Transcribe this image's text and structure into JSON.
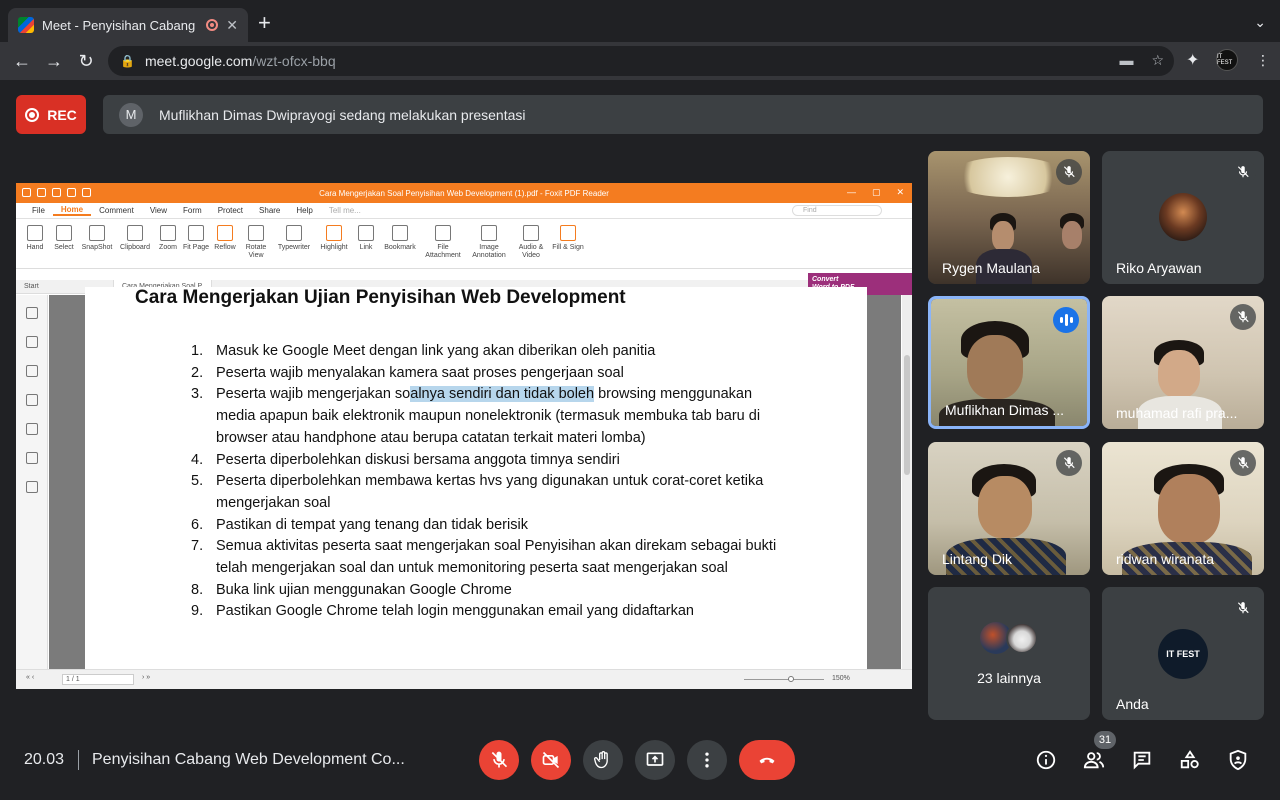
{
  "browser": {
    "tab_title": "Meet - Penyisihan Cabang",
    "url_host": "meet.google.com",
    "url_path": "/wzt-ofcx-bbq",
    "new_tab_glyph": "+",
    "profile_label": "IT FEST"
  },
  "meet": {
    "rec_label": "REC",
    "presenter_initial": "M",
    "presenting_message": "Muflikhan Dimas Dwiprayogi sedang melakukan presentasi",
    "clock": "20.03",
    "meeting_title": "Penyisihan Cabang Web Development Co...",
    "participant_count": "31"
  },
  "foxit": {
    "window_title": "Cara Mengerjakan Soal Penyisihan Web Development (1).pdf - Foxit PDF Reader",
    "menu": [
      "File",
      "Home",
      "Comment",
      "View",
      "Form",
      "Protect",
      "Share",
      "Help"
    ],
    "tell_me": "Tell me...",
    "find_placeholder": "Find",
    "ribbon": [
      "Hand",
      "Select",
      "SnapShot",
      "Clipboard",
      "Zoom",
      "Fit Page",
      "Reflow",
      "Rotate View",
      "Typewriter",
      "Highlight",
      "Link",
      "Bookmark",
      "File Attachment",
      "Image Annotation",
      "Audio & Video",
      "Fill & Sign"
    ],
    "convert_label_1": "Convert",
    "convert_label_2": "Word to PDF",
    "tabs": [
      "Start",
      "Cara Mengerjakan Soal P..."
    ],
    "page_indicator": "1 / 1",
    "zoom_level": "150%"
  },
  "document": {
    "heading": "Cara Mengerjakan Ujian Penyisihan Web Development",
    "items": [
      {
        "num": "1.",
        "text": "Masuk ke Google Meet dengan link yang akan diberikan oleh panitia"
      },
      {
        "num": "2.",
        "text": "Peserta wajib menyalakan kamera saat proses pengerjaan soal"
      },
      {
        "num": "3.",
        "text_before": "Peserta wajib mengerjakan so",
        "text_highlight": "alnya sendiri dan tidak boleh",
        "text_after": " browsing menggunakan media apapun baik elektronik maupun nonelektronik (termasuk membuka tab baru di browser atau handphone atau berupa catatan terkait materi lomba)"
      },
      {
        "num": "4.",
        "text": "Peserta diperbolehkan diskusi bersama anggota timnya sendiri"
      },
      {
        "num": "5.",
        "text": "Peserta diperbolehkan membawa kertas hvs yang digunakan untuk corat-coret ketika mengerjakan soal"
      },
      {
        "num": "6.",
        "text": "Pastikan di tempat yang tenang dan tidak berisik"
      },
      {
        "num": "7.",
        "text": "Semua aktivitas peserta saat mengerjakan soal Penyisihan akan direkam sebagai bukti telah mengerjakan soal dan untuk memonitoring peserta saat mengerjakan soal"
      },
      {
        "num": "8.",
        "text": "Buka link ujian menggunakan Google Chrome"
      },
      {
        "num": "9.",
        "text": "Pastikan Google Chrome telah login menggunakan email yang didaftarkan"
      }
    ]
  },
  "participants": [
    {
      "name": "Rygen Maulana",
      "muted": true
    },
    {
      "name": "Riko Aryawan",
      "muted": true
    },
    {
      "name": "Muflikhan Dimas ...",
      "muted": false,
      "speaking": true
    },
    {
      "name": "muhamad rafi pra...",
      "muted": true
    },
    {
      "name": "Lintang Dik",
      "muted": true
    },
    {
      "name": "ridwan wiranata",
      "muted": true
    },
    {
      "name": "23 lainnya",
      "muted": false
    },
    {
      "name": "Anda",
      "muted": true
    }
  ],
  "colors": {
    "rec_red": "#d93025",
    "control_red": "#ea4335",
    "active_border": "#8ab4f8",
    "foxit_orange": "#f47c20"
  },
  "icons": [
    "back-icon",
    "forward-icon",
    "reload-icon",
    "lock-icon",
    "camera-blocked-icon",
    "star-icon",
    "extensions-icon",
    "mic-off-icon",
    "camera-off-icon",
    "raise-hand-icon",
    "present-icon",
    "more-icon",
    "hang-up-icon",
    "info-icon",
    "people-icon",
    "chat-icon",
    "activities-icon",
    "host-controls-icon"
  ]
}
